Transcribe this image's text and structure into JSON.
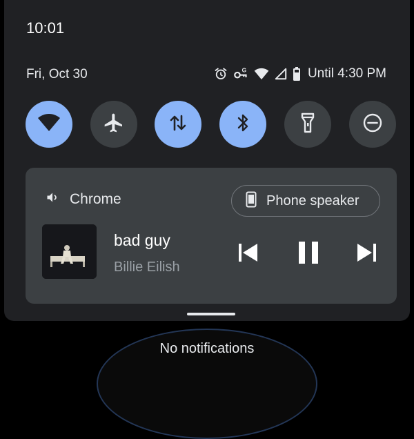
{
  "status_bar": {
    "time": "10:01"
  },
  "header": {
    "date": "Fri, Oct 30",
    "battery_text": "Until 4:30 PM",
    "status_icons": [
      "alarm-icon",
      "vpn-key-icon",
      "wifi-signal-icon",
      "cell-signal-icon",
      "battery-icon"
    ]
  },
  "quick_settings": [
    {
      "name": "wifi",
      "icon": "wifi-icon",
      "state": "on"
    },
    {
      "name": "airplane-mode",
      "icon": "airplane-icon",
      "state": "off"
    },
    {
      "name": "mobile-data",
      "icon": "data-transfer-icon",
      "state": "on"
    },
    {
      "name": "bluetooth",
      "icon": "bluetooth-icon",
      "state": "on"
    },
    {
      "name": "flashlight",
      "icon": "flashlight-icon",
      "state": "off"
    },
    {
      "name": "do-not-disturb",
      "icon": "dnd-icon",
      "state": "off"
    }
  ],
  "media": {
    "app_name": "Chrome",
    "output_device": "Phone speaker",
    "title": "bad guy",
    "artist": "Billie Eilish"
  },
  "notifications": {
    "empty_text": "No notifications"
  },
  "colors": {
    "tile_on": "#8ab4f8",
    "tile_off": "#3c4043",
    "panel": "#202124",
    "media_card": "#3c4043"
  }
}
